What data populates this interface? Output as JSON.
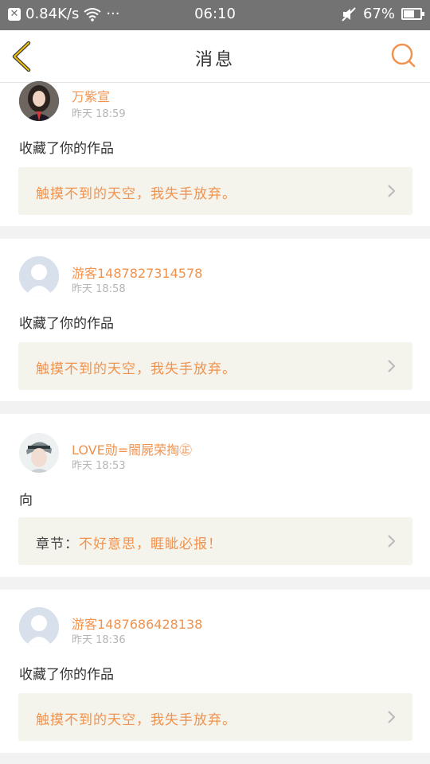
{
  "status_bar": {
    "network_speed": "0.84K/s",
    "more": "···",
    "time": "06:10",
    "battery": "67%",
    "battery_level": 0.67
  },
  "nav": {
    "title": "消息"
  },
  "messages": [
    {
      "name": "万紫宣",
      "time": "昨天 18:59",
      "action": "收藏了你的作品",
      "quote": "触摸不到的天空，我失手放弃。",
      "avatar": "photo"
    },
    {
      "name": "游客1487827314578",
      "time": "昨天 18:58",
      "action": "收藏了你的作品",
      "quote": "触摸不到的天空，我失手放弃。",
      "avatar": "default"
    },
    {
      "name": "LOVE勋=䦣屍荣掏㊣",
      "time": "昨天 18:53",
      "action": "向",
      "quote_prefix": "章节：",
      "quote": "不好意思，睚眦必报！",
      "avatar": "photo2"
    },
    {
      "name": "游客1487686428138",
      "time": "昨天 18:36",
      "action": "收藏了你的作品",
      "quote": "触摸不到的天空，我失手放弃。",
      "avatar": "default"
    }
  ],
  "colors": {
    "accent": "#f0934f",
    "status_bar": "#737373",
    "quote_bg": "#f4f3ec"
  }
}
